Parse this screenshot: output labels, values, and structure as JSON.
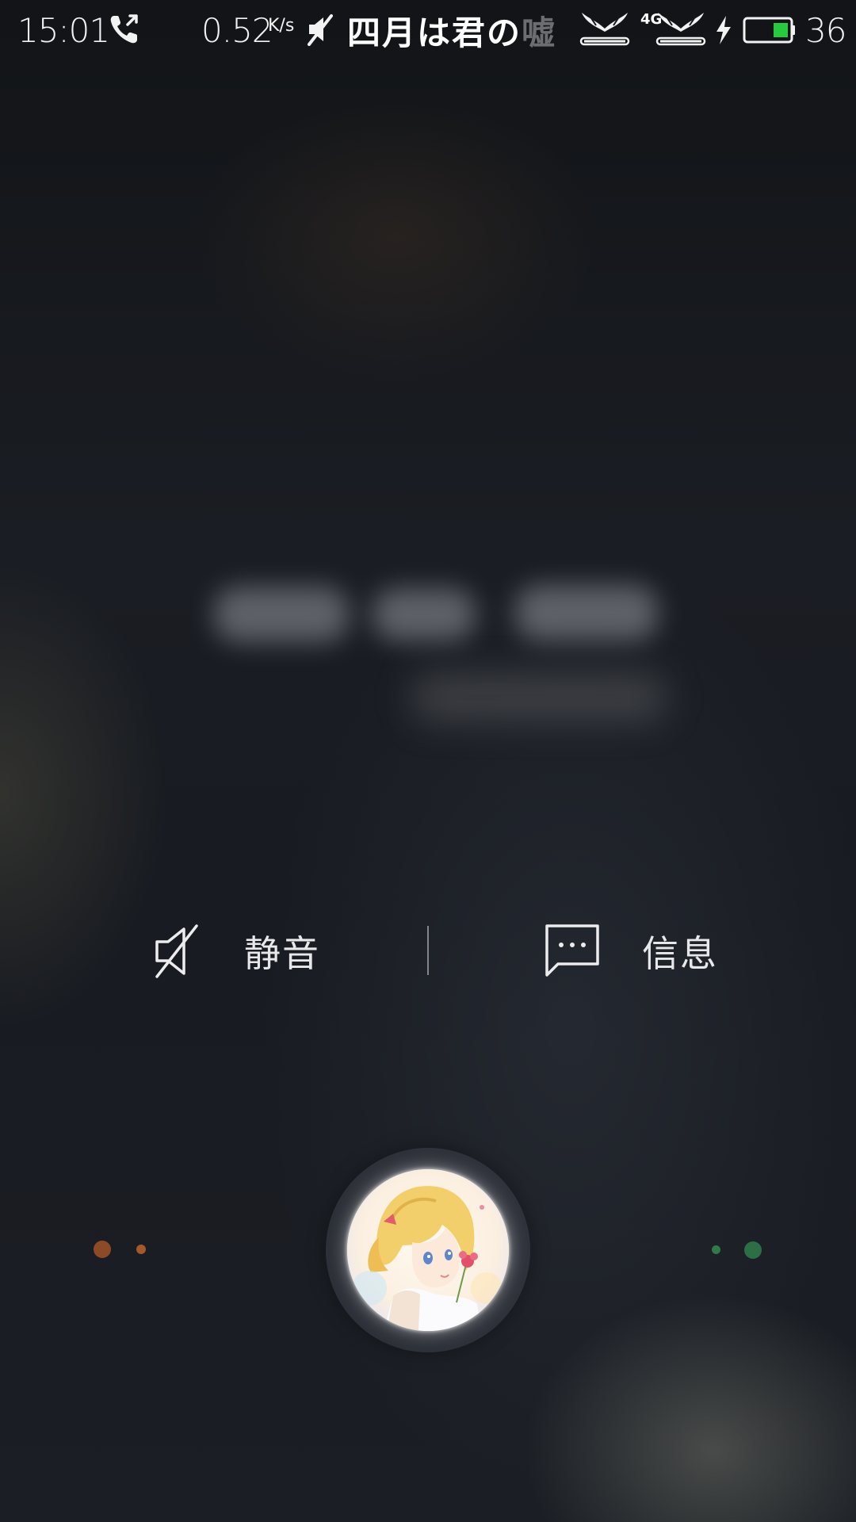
{
  "status_bar": {
    "time": "15:01",
    "net_speed": "0.52",
    "net_speed_unit": "K/s",
    "carrier_main": "四月は君の",
    "carrier_faded": "嘘",
    "network_type": "4G",
    "battery_level": "36",
    "icons": [
      "call-in-progress-icon",
      "mute-icon",
      "signal-icon",
      "signal-icon",
      "charging-icon",
      "battery-icon"
    ],
    "battery_color": "#27c93f"
  },
  "caller": {
    "name_hidden": true
  },
  "actions": {
    "mute": {
      "label": "静音",
      "icon": "mute-icon"
    },
    "message": {
      "label": "信息",
      "icon": "message-bubble-icon"
    }
  },
  "answer_slider": {
    "avatar_icon": "contact-avatar",
    "decline_color": "#8c4a26",
    "answer_color": "#2c6e46"
  }
}
